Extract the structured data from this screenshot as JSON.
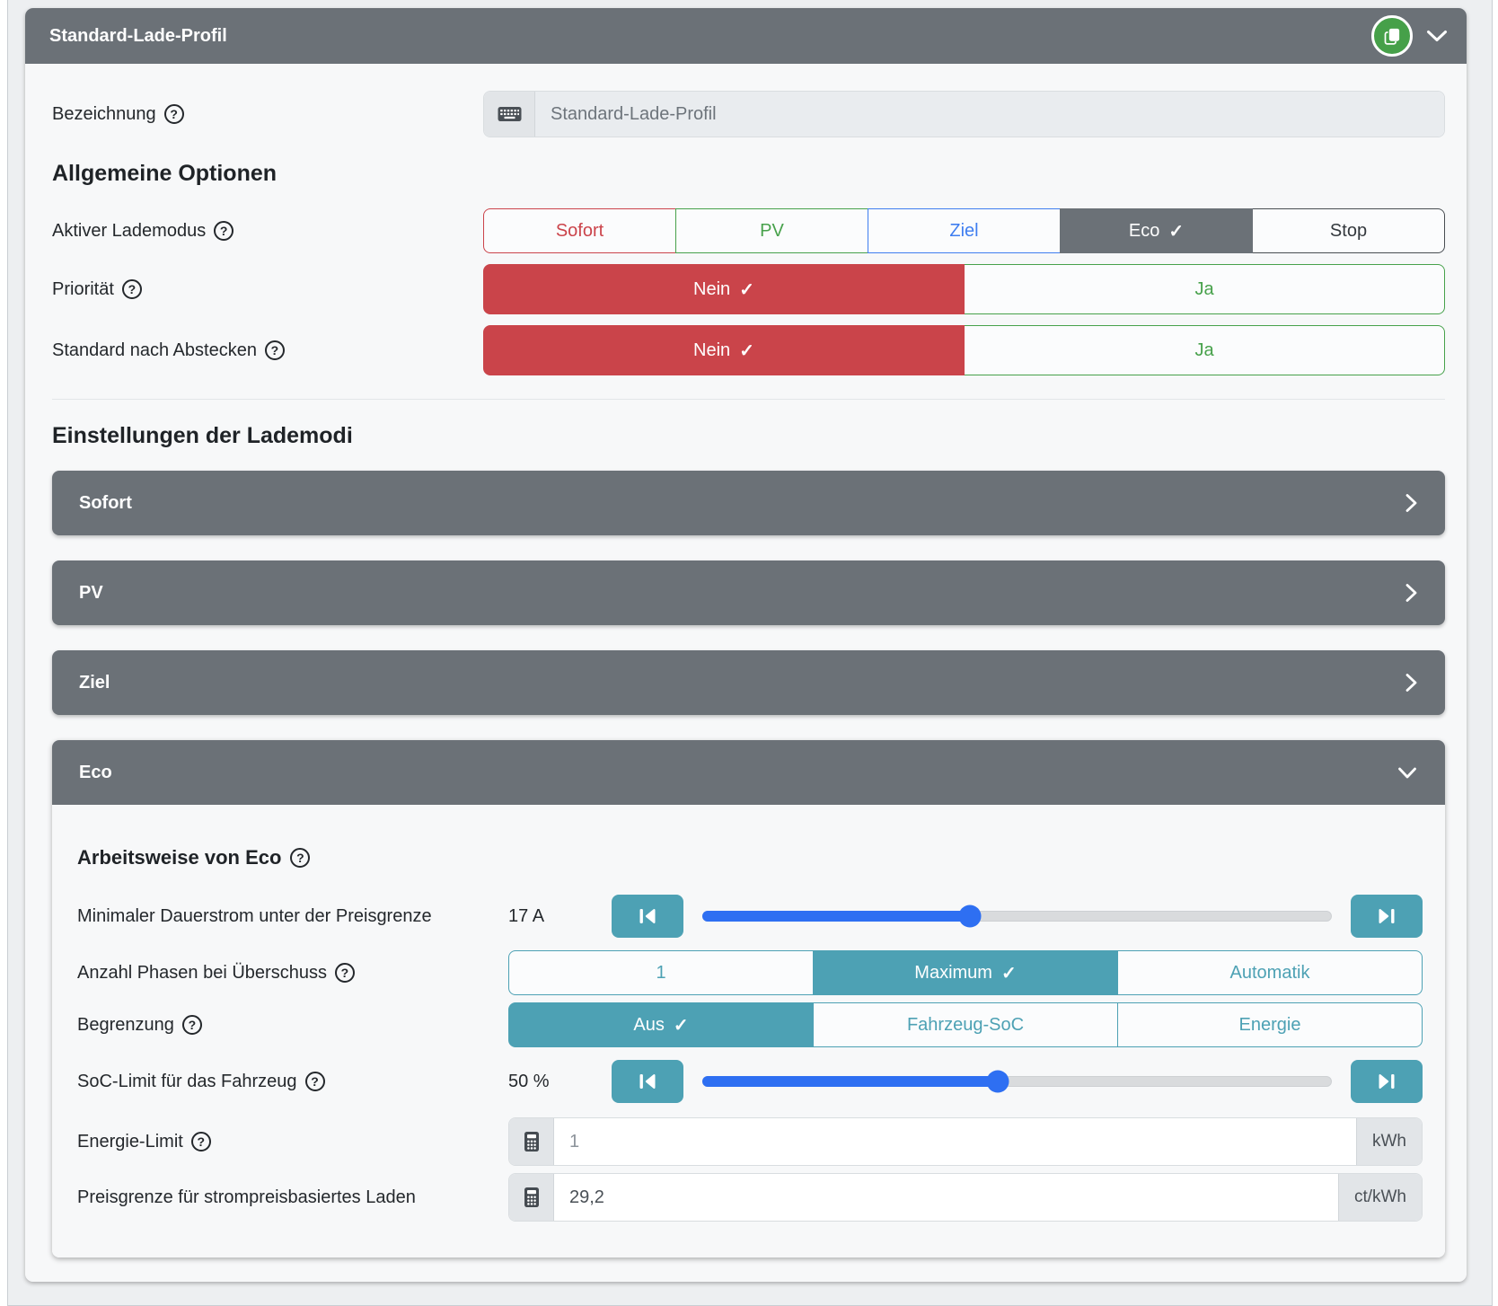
{
  "icons": {
    "check": "✓",
    "help": "?"
  },
  "header": {
    "title": "Standard-Lade-Profil"
  },
  "bezeichnung": {
    "label": "Bezeichnung",
    "value": "Standard-Lade-Profil"
  },
  "general": {
    "heading": "Allgemeine Optionen",
    "mode": {
      "label": "Aktiver Lademodus",
      "selected": "Eco",
      "options": [
        {
          "label": "Sofort",
          "color": "#cb444b"
        },
        {
          "label": "PV",
          "color": "#47a14b"
        },
        {
          "label": "Ziel",
          "color": "#3f7ef0"
        },
        {
          "label": "Eco",
          "color": "#6b7177"
        },
        {
          "label": "Stop",
          "color": "#33383d"
        }
      ]
    },
    "priority": {
      "label": "Priorität",
      "selected": "Nein",
      "options": [
        {
          "label": "Nein"
        },
        {
          "label": "Ja"
        }
      ]
    },
    "default_after_unplug": {
      "label": "Standard nach Abstecken",
      "selected": "Nein",
      "options": [
        {
          "label": "Nein"
        },
        {
          "label": "Ja"
        }
      ]
    }
  },
  "mode_settings": {
    "heading": "Einstellungen der Lademodi",
    "panels": [
      {
        "label": "Sofort",
        "expanded": false
      },
      {
        "label": "PV",
        "expanded": false
      },
      {
        "label": "Ziel",
        "expanded": false
      },
      {
        "label": "Eco",
        "expanded": true
      }
    ]
  },
  "eco": {
    "heading": "Arbeitsweise von Eco",
    "min_current": {
      "label": "Minimaler Dauerstrom unter der Preisgrenze",
      "value": "17 A",
      "slider_percent": 42.5
    },
    "phases": {
      "label": "Anzahl Phasen bei Überschuss",
      "selected": "Maximum",
      "options": [
        {
          "label": "1"
        },
        {
          "label": "Maximum"
        },
        {
          "label": "Automatik"
        }
      ]
    },
    "limit": {
      "label": "Begrenzung",
      "selected": "Aus",
      "options": [
        {
          "label": "Aus"
        },
        {
          "label": "Fahrzeug-SoC"
        },
        {
          "label": "Energie"
        }
      ]
    },
    "soc_limit": {
      "label": "SoC-Limit für das Fahrzeug",
      "value": "50 %",
      "slider_percent": 47
    },
    "energy_limit": {
      "label": "Energie-Limit",
      "value": "1",
      "unit": "kWh"
    },
    "price_limit": {
      "label": "Preisgrenze für strompreisbasiertes Laden",
      "value": "29,2",
      "unit": "ct/kWh"
    }
  },
  "colors": {
    "header_gray": "#6b7177",
    "card_bg": "#f7f8f9",
    "page_bg": "#edeff1",
    "red": "#cb444b",
    "green": "#47a14b",
    "blue": "#3f7ef0",
    "teal": "#4da1b4",
    "slider_blue": "#2e6ff2",
    "duplicate_green": "#46a049"
  }
}
